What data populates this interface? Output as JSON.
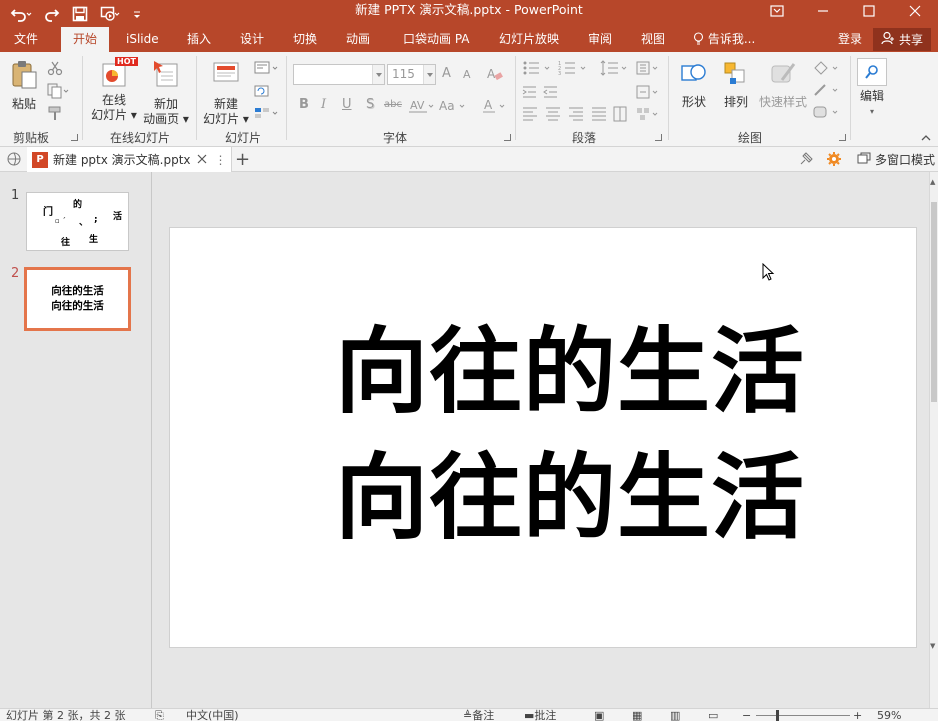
{
  "titlebar": {
    "title": "新建 PPTX 演示文稿.pptx - PowerPoint",
    "color": "#b7472a"
  },
  "tabs": [
    {
      "label": "文件"
    },
    {
      "label": "开始"
    },
    {
      "label": "iSlide"
    },
    {
      "label": "插入"
    },
    {
      "label": "设计"
    },
    {
      "label": "切换"
    },
    {
      "label": "动画"
    },
    {
      "label": "口袋动画 PA"
    },
    {
      "label": "幻灯片放映"
    },
    {
      "label": "审阅"
    },
    {
      "label": "视图"
    },
    {
      "label": "告诉我..."
    }
  ],
  "account": {
    "login": "登录",
    "share": "共享"
  },
  "ribbon": {
    "clipboard": {
      "paste": "粘贴",
      "group": "剪贴板"
    },
    "online_slides": {
      "online": "在线幻灯片",
      "online_line1": "在线",
      "online_line2": "幻灯片 ▾",
      "new_anim_line1": "新加",
      "new_anim_line2": "动画页 ▾",
      "hot_badge": "HOT",
      "group": "在线幻灯片"
    },
    "slides": {
      "new_line1": "新建",
      "new_line2": "幻灯片 ▾",
      "group": "幻灯片"
    },
    "font": {
      "font_name": "",
      "font_size": "115",
      "group": "字体",
      "bold": "B",
      "italic": "I",
      "underline": "U",
      "shadow": "S",
      "strike": "abc",
      "grow": "A",
      "shrink": "A"
    },
    "paragraph": {
      "group": "段落"
    },
    "drawing": {
      "shapes": "形状",
      "arrange": "排列",
      "quick_styles": "快速样式",
      "group": "绘图"
    },
    "editing": {
      "label": "编辑"
    }
  },
  "doc_tab": {
    "label": "新建 pptx 演示文稿.pptx",
    "icon_letter": "P"
  },
  "multi_window": "多窗口模式",
  "thumbnails": [
    {
      "number": "1",
      "chars": [
        "门",
        "的",
        "活",
        "、",
        "往",
        "生"
      ]
    },
    {
      "number": "2",
      "lines": [
        "向往的生活",
        "向往的生活"
      ]
    }
  ],
  "slide": {
    "lines": [
      "向往的生活",
      "向往的生活"
    ]
  },
  "status": {
    "slide_info": "幻灯片 第 2 张，共 2 张",
    "language": "中文(中国)",
    "notes": "备注",
    "comments": "批注",
    "zoom": "59%"
  }
}
